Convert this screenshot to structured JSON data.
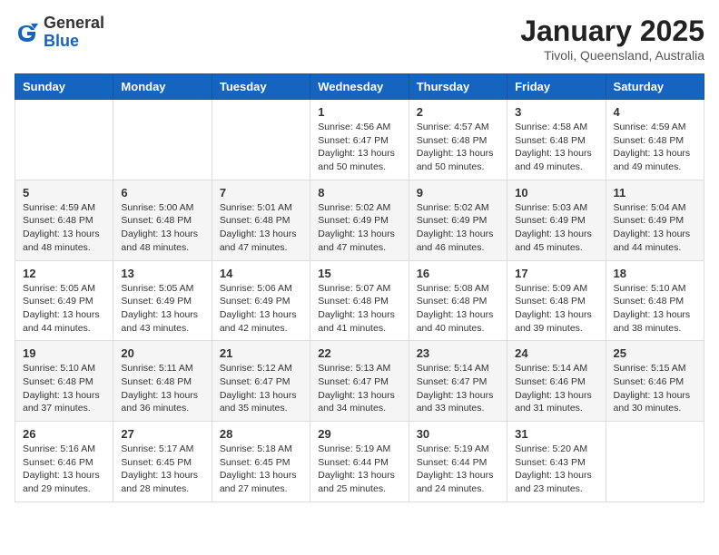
{
  "logo": {
    "general": "General",
    "blue": "Blue"
  },
  "header": {
    "month_year": "January 2025",
    "location": "Tivoli, Queensland, Australia"
  },
  "weekdays": [
    "Sunday",
    "Monday",
    "Tuesday",
    "Wednesday",
    "Thursday",
    "Friday",
    "Saturday"
  ],
  "weeks": [
    [
      {
        "day": "",
        "content": ""
      },
      {
        "day": "",
        "content": ""
      },
      {
        "day": "",
        "content": ""
      },
      {
        "day": "1",
        "content": "Sunrise: 4:56 AM\nSunset: 6:47 PM\nDaylight: 13 hours and 50 minutes."
      },
      {
        "day": "2",
        "content": "Sunrise: 4:57 AM\nSunset: 6:48 PM\nDaylight: 13 hours and 50 minutes."
      },
      {
        "day": "3",
        "content": "Sunrise: 4:58 AM\nSunset: 6:48 PM\nDaylight: 13 hours and 49 minutes."
      },
      {
        "day": "4",
        "content": "Sunrise: 4:59 AM\nSunset: 6:48 PM\nDaylight: 13 hours and 49 minutes."
      }
    ],
    [
      {
        "day": "5",
        "content": "Sunrise: 4:59 AM\nSunset: 6:48 PM\nDaylight: 13 hours and 48 minutes."
      },
      {
        "day": "6",
        "content": "Sunrise: 5:00 AM\nSunset: 6:48 PM\nDaylight: 13 hours and 48 minutes."
      },
      {
        "day": "7",
        "content": "Sunrise: 5:01 AM\nSunset: 6:48 PM\nDaylight: 13 hours and 47 minutes."
      },
      {
        "day": "8",
        "content": "Sunrise: 5:02 AM\nSunset: 6:49 PM\nDaylight: 13 hours and 47 minutes."
      },
      {
        "day": "9",
        "content": "Sunrise: 5:02 AM\nSunset: 6:49 PM\nDaylight: 13 hours and 46 minutes."
      },
      {
        "day": "10",
        "content": "Sunrise: 5:03 AM\nSunset: 6:49 PM\nDaylight: 13 hours and 45 minutes."
      },
      {
        "day": "11",
        "content": "Sunrise: 5:04 AM\nSunset: 6:49 PM\nDaylight: 13 hours and 44 minutes."
      }
    ],
    [
      {
        "day": "12",
        "content": "Sunrise: 5:05 AM\nSunset: 6:49 PM\nDaylight: 13 hours and 44 minutes."
      },
      {
        "day": "13",
        "content": "Sunrise: 5:05 AM\nSunset: 6:49 PM\nDaylight: 13 hours and 43 minutes."
      },
      {
        "day": "14",
        "content": "Sunrise: 5:06 AM\nSunset: 6:49 PM\nDaylight: 13 hours and 42 minutes."
      },
      {
        "day": "15",
        "content": "Sunrise: 5:07 AM\nSunset: 6:48 PM\nDaylight: 13 hours and 41 minutes."
      },
      {
        "day": "16",
        "content": "Sunrise: 5:08 AM\nSunset: 6:48 PM\nDaylight: 13 hours and 40 minutes."
      },
      {
        "day": "17",
        "content": "Sunrise: 5:09 AM\nSunset: 6:48 PM\nDaylight: 13 hours and 39 minutes."
      },
      {
        "day": "18",
        "content": "Sunrise: 5:10 AM\nSunset: 6:48 PM\nDaylight: 13 hours and 38 minutes."
      }
    ],
    [
      {
        "day": "19",
        "content": "Sunrise: 5:10 AM\nSunset: 6:48 PM\nDaylight: 13 hours and 37 minutes."
      },
      {
        "day": "20",
        "content": "Sunrise: 5:11 AM\nSunset: 6:48 PM\nDaylight: 13 hours and 36 minutes."
      },
      {
        "day": "21",
        "content": "Sunrise: 5:12 AM\nSunset: 6:47 PM\nDaylight: 13 hours and 35 minutes."
      },
      {
        "day": "22",
        "content": "Sunrise: 5:13 AM\nSunset: 6:47 PM\nDaylight: 13 hours and 34 minutes."
      },
      {
        "day": "23",
        "content": "Sunrise: 5:14 AM\nSunset: 6:47 PM\nDaylight: 13 hours and 33 minutes."
      },
      {
        "day": "24",
        "content": "Sunrise: 5:14 AM\nSunset: 6:46 PM\nDaylight: 13 hours and 31 minutes."
      },
      {
        "day": "25",
        "content": "Sunrise: 5:15 AM\nSunset: 6:46 PM\nDaylight: 13 hours and 30 minutes."
      }
    ],
    [
      {
        "day": "26",
        "content": "Sunrise: 5:16 AM\nSunset: 6:46 PM\nDaylight: 13 hours and 29 minutes."
      },
      {
        "day": "27",
        "content": "Sunrise: 5:17 AM\nSunset: 6:45 PM\nDaylight: 13 hours and 28 minutes."
      },
      {
        "day": "28",
        "content": "Sunrise: 5:18 AM\nSunset: 6:45 PM\nDaylight: 13 hours and 27 minutes."
      },
      {
        "day": "29",
        "content": "Sunrise: 5:19 AM\nSunset: 6:44 PM\nDaylight: 13 hours and 25 minutes."
      },
      {
        "day": "30",
        "content": "Sunrise: 5:19 AM\nSunset: 6:44 PM\nDaylight: 13 hours and 24 minutes."
      },
      {
        "day": "31",
        "content": "Sunrise: 5:20 AM\nSunset: 6:43 PM\nDaylight: 13 hours and 23 minutes."
      },
      {
        "day": "",
        "content": ""
      }
    ]
  ]
}
